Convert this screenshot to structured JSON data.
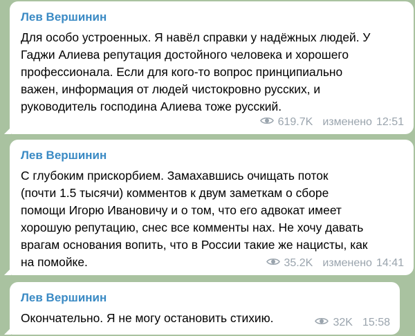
{
  "messages": [
    {
      "author": "Лев Вершинин",
      "text": "Для особо устроенных. Я навёл справки у надёжных людей. У\nГаджи Алиева репутация достойного человека и хорошего\nпрофессионала. Если для кого-то вопрос принципиально\nважен, информация от людей чистокровно русских, и\nруководитель господина Алиева тоже русский.",
      "views": "619.7K",
      "edited": "изменено",
      "time": "12:51"
    },
    {
      "author": "Лев Вершинин",
      "text": "С глубоким прискорбием. Замахавшись очищать поток\n(почти 1.5 тысячи) комментов к двум заметкам о сборе\nпомощи Игорю Ивановичу и о том, что его адвокат имеет\nхорошую репутацию, снес все комменты нах. Не хочу давать\nврагам основания вопить, что в России такие же нацисты, как\nна помойке.",
      "views": "35.2K",
      "edited": "изменено",
      "time": "14:41"
    },
    {
      "author": "Лев Вершинин",
      "text": "Окончательно. Я не могу остановить стихию.",
      "views": "32K",
      "time": "15:58"
    }
  ],
  "icons": {
    "views": "eye-icon"
  },
  "colors": {
    "background": "#a9c2a0",
    "bubble": "#ffffff",
    "author": "#3a8ac4",
    "meta": "#9aa4ad"
  }
}
